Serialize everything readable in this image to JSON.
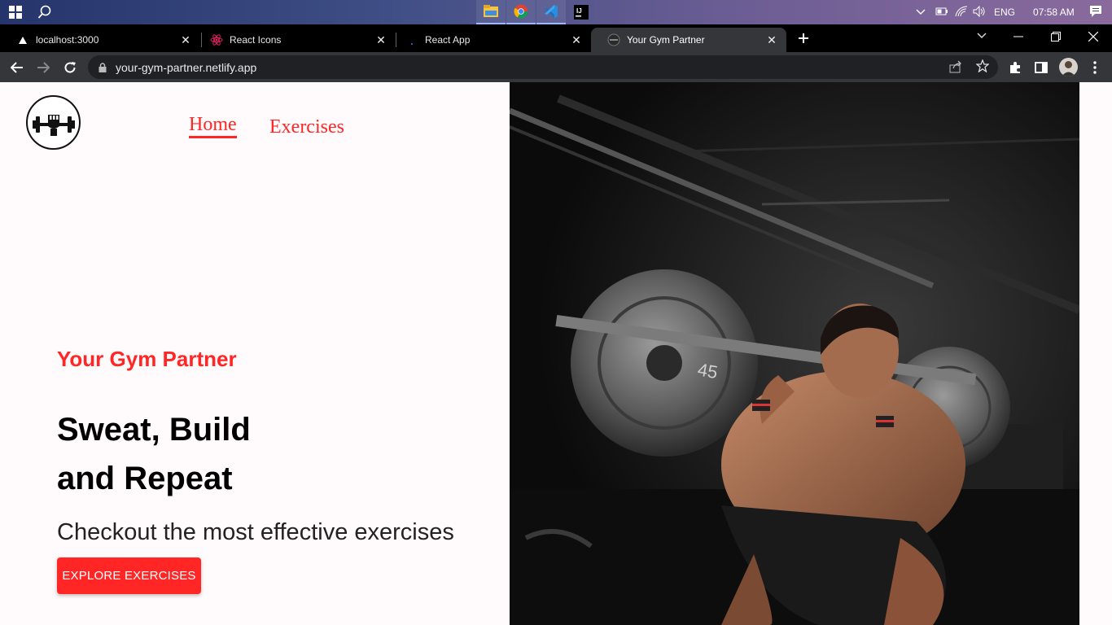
{
  "taskbar": {
    "tray_lang": "ENG",
    "tray_time": "07:58 AM",
    "apps": [
      "file-explorer-icon",
      "chrome-icon",
      "vscode-icon",
      "intellij-icon"
    ]
  },
  "tabs": [
    {
      "title": "localhost:3000",
      "favicon": "triangle-icon"
    },
    {
      "title": "React Icons",
      "favicon": "react-icon"
    },
    {
      "title": "React App",
      "favicon": "react-app-icon"
    },
    {
      "title": "Your Gym Partner",
      "favicon": "gym-favicon"
    }
  ],
  "address_bar": {
    "url": "your-gym-partner.netlify.app"
  },
  "navbar": {
    "home": "Home",
    "exercises": "Exercises"
  },
  "hero": {
    "brand": "Your Gym Partner",
    "headline_line1": "Sweat, Build",
    "headline_line2": "and Repeat",
    "subline": "Checkout the most effective exercises",
    "button": "EXPLORE EXERCISES"
  },
  "colors": {
    "accent": "#ff2625",
    "page_bg": "#fffafb"
  }
}
